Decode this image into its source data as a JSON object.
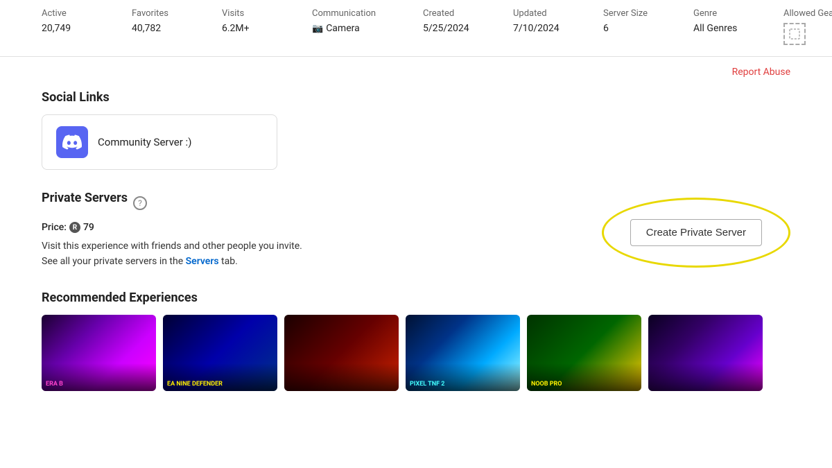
{
  "stats": {
    "columns": [
      {
        "label": "Active",
        "value": "20,749"
      },
      {
        "label": "Favorites",
        "value": "40,782"
      },
      {
        "label": "Visits",
        "value": "6.2M+"
      },
      {
        "label": "Communication",
        "value": "Camera",
        "type": "communication"
      },
      {
        "label": "Created",
        "value": "5/25/2024"
      },
      {
        "label": "Updated",
        "value": "7/10/2024"
      },
      {
        "label": "Server Size",
        "value": "6"
      },
      {
        "label": "Genre",
        "value": "All Genres"
      },
      {
        "label": "Allowed Gear",
        "value": "",
        "type": "gear"
      }
    ]
  },
  "report": {
    "label": "Report Abuse"
  },
  "social_links": {
    "title": "Social Links",
    "discord": {
      "label": "Community Server :)"
    }
  },
  "private_servers": {
    "title": "Private Servers",
    "price_label": "Price:",
    "price_value": "79",
    "description_line1": "Visit this experience with friends and other people you invite.",
    "description_line2_prefix": "See all your private servers in the ",
    "description_link": "Servers",
    "description_line2_suffix": " tab.",
    "create_button": "Create Private Server"
  },
  "recommended": {
    "title": "Recommended Experiences",
    "thumbnails": [
      {
        "class": "thumb-1",
        "text": "ERA B",
        "text_class": "pink"
      },
      {
        "class": "thumb-2",
        "text": "EA NINE DEFENDER",
        "text_class": "yellow"
      },
      {
        "class": "thumb-3",
        "text": "",
        "text_class": ""
      },
      {
        "class": "thumb-4",
        "text": "PIXEL TNF 2",
        "text_class": "cyan"
      },
      {
        "class": "thumb-5",
        "text": "NOOB PRO",
        "text_class": "yellow"
      },
      {
        "class": "thumb-6",
        "text": "",
        "text_class": "green"
      }
    ]
  }
}
